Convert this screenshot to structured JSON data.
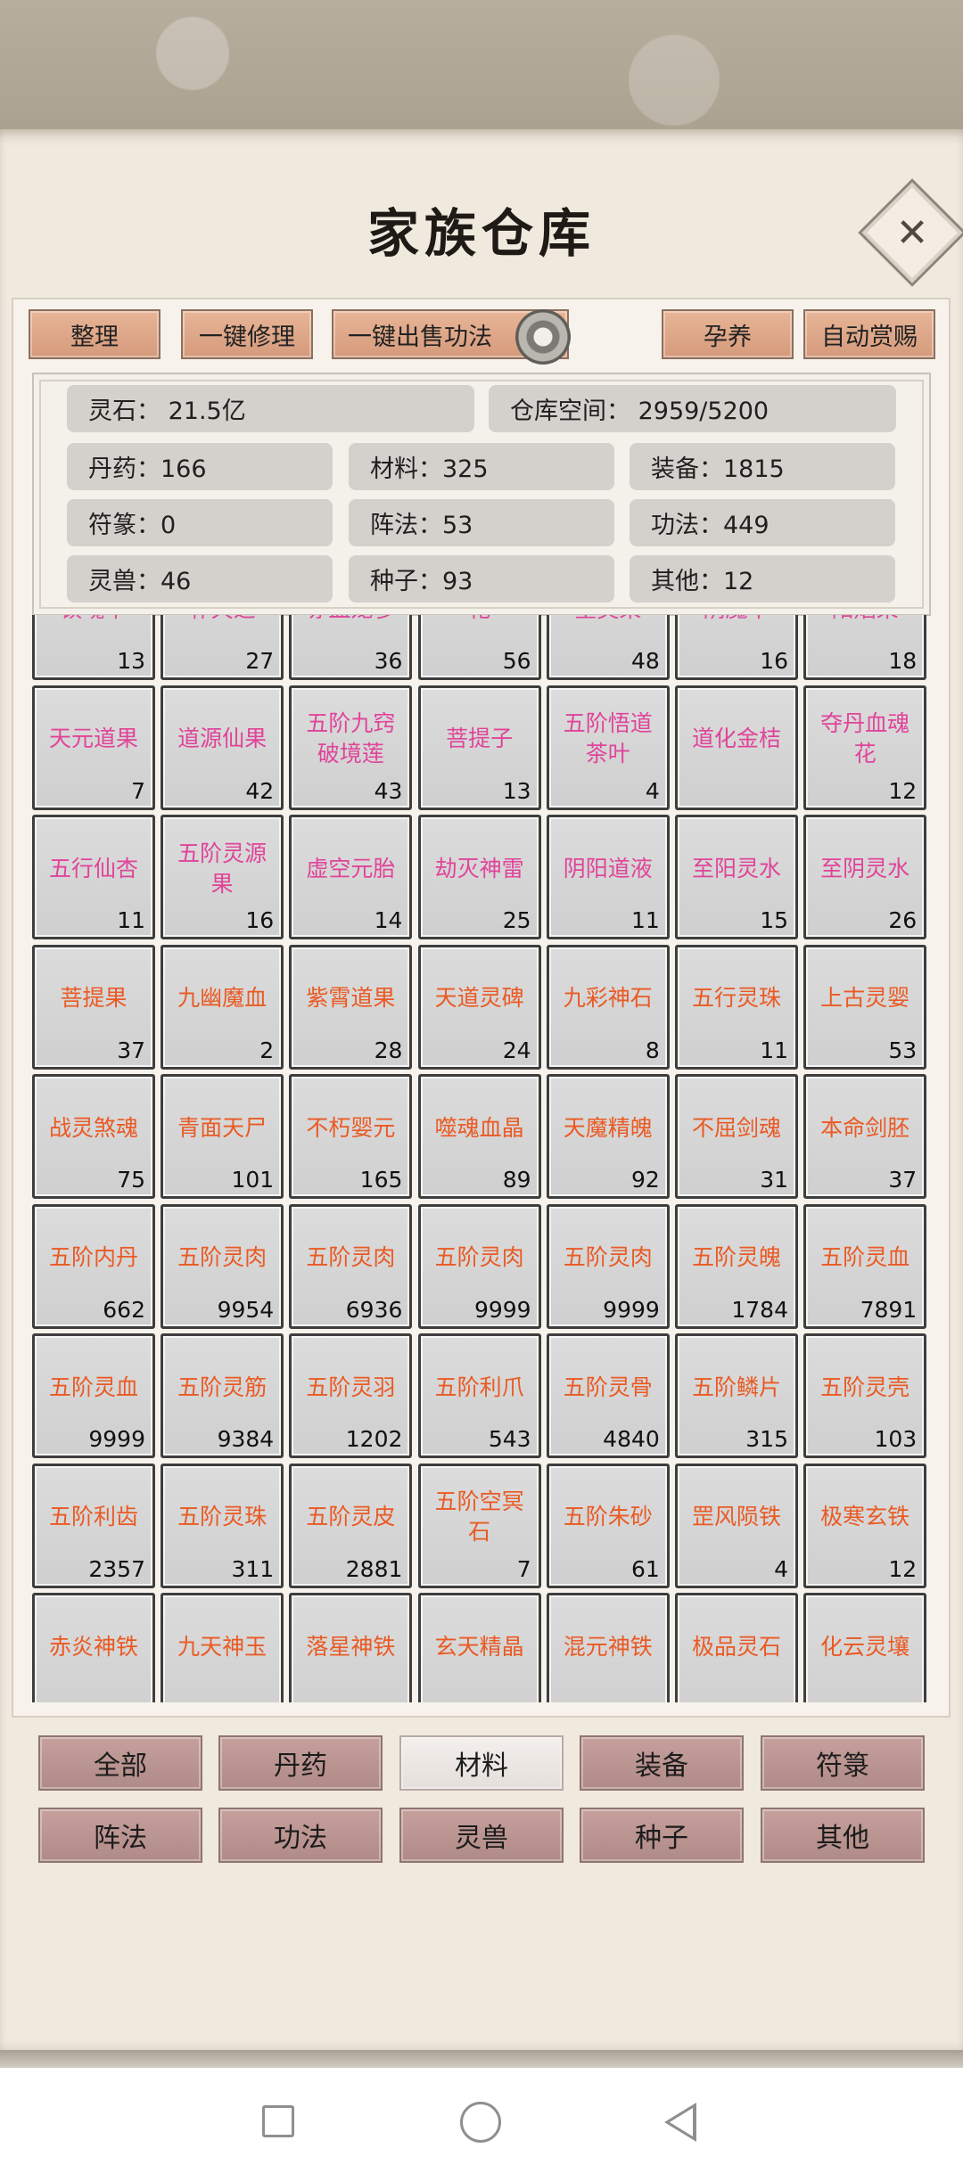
{
  "title": "家族仓库",
  "top_buttons": [
    "整理",
    "一键修理",
    "一键出售功法",
    "孕养",
    "自动赏赐"
  ],
  "info": {
    "spirit_stone": "灵石：  21.5亿",
    "storage": "仓库空间：    2959/5200",
    "stats": [
      "丹药：166",
      "材料：325",
      "装备：1815",
      "符篆：0",
      "阵法：53",
      "功法：449",
      "灵兽：46",
      "种子：93",
      "其他：12"
    ]
  },
  "items": [
    {
      "name": "镇魂草",
      "count": "13",
      "color": "#e0449a"
    },
    {
      "name": "补天芝",
      "count": "27",
      "color": "#e0449a"
    },
    {
      "name": "赤血龙参",
      "count": "36",
      "color": "#e0449a"
    },
    {
      "name": "花",
      "count": "56",
      "color": "#e0449a"
    },
    {
      "name": "星灵果",
      "count": "48",
      "color": "#e0449a"
    },
    {
      "name": "阴魔草",
      "count": "16",
      "color": "#e0449a"
    },
    {
      "name": "阳焰果",
      "count": "18",
      "color": "#e0449a"
    },
    {
      "name": "天元道果",
      "count": "7",
      "color": "#e0449a"
    },
    {
      "name": "道源仙果",
      "count": "42",
      "color": "#e0449a"
    },
    {
      "name": "五阶九窍破境莲",
      "count": "43",
      "color": "#e0449a"
    },
    {
      "name": "菩提子",
      "count": "13",
      "color": "#e0449a"
    },
    {
      "name": "五阶悟道茶叶",
      "count": "4",
      "color": "#e0449a"
    },
    {
      "name": "道化金桔",
      "count": "",
      "color": "#e0449a"
    },
    {
      "name": "夺丹血魂花",
      "count": "12",
      "color": "#e0449a"
    },
    {
      "name": "五行仙杏",
      "count": "11",
      "color": "#e0449a"
    },
    {
      "name": "五阶灵源果",
      "count": "16",
      "color": "#e0449a"
    },
    {
      "name": "虚空元胎",
      "count": "14",
      "color": "#e0449a"
    },
    {
      "name": "劫灭神雷",
      "count": "25",
      "color": "#e0449a"
    },
    {
      "name": "阴阳道液",
      "count": "11",
      "color": "#e0449a"
    },
    {
      "name": "至阳灵水",
      "count": "15",
      "color": "#e0449a"
    },
    {
      "name": "至阴灵水",
      "count": "26",
      "color": "#e0449a"
    },
    {
      "name": "菩提果",
      "count": "37",
      "color": "#ea5a24"
    },
    {
      "name": "九幽魔血",
      "count": "2",
      "color": "#ea5a24"
    },
    {
      "name": "紫霄道果",
      "count": "28",
      "color": "#ea5a24"
    },
    {
      "name": "天道灵碑",
      "count": "24",
      "color": "#ea5a24"
    },
    {
      "name": "九彩神石",
      "count": "8",
      "color": "#ea5a24"
    },
    {
      "name": "五行灵珠",
      "count": "11",
      "color": "#ea5a24"
    },
    {
      "name": "上古灵婴",
      "count": "53",
      "color": "#ea5a24"
    },
    {
      "name": "战灵煞魂",
      "count": "75",
      "color": "#ea5a24"
    },
    {
      "name": "青面天尸",
      "count": "101",
      "color": "#ea5a24"
    },
    {
      "name": "不朽婴元",
      "count": "165",
      "color": "#ea5a24"
    },
    {
      "name": "噬魂血晶",
      "count": "89",
      "color": "#ea5a24"
    },
    {
      "name": "天魔精魄",
      "count": "92",
      "color": "#ea5a24"
    },
    {
      "name": "不屈剑魂",
      "count": "31",
      "color": "#ea5a24"
    },
    {
      "name": "本命剑胚",
      "count": "37",
      "color": "#ea5a24"
    },
    {
      "name": "五阶内丹",
      "count": "662",
      "color": "#ea5a24"
    },
    {
      "name": "五阶灵肉",
      "count": "9954",
      "color": "#ea5a24"
    },
    {
      "name": "五阶灵肉",
      "count": "6936",
      "color": "#ea5a24"
    },
    {
      "name": "五阶灵肉",
      "count": "9999",
      "color": "#ea5a24"
    },
    {
      "name": "五阶灵肉",
      "count": "9999",
      "color": "#ea5a24"
    },
    {
      "name": "五阶灵魄",
      "count": "1784",
      "color": "#ea5a24"
    },
    {
      "name": "五阶灵血",
      "count": "7891",
      "color": "#ea5a24"
    },
    {
      "name": "五阶灵血",
      "count": "9999",
      "color": "#ea5a24"
    },
    {
      "name": "五阶灵筋",
      "count": "9384",
      "color": "#ea5a24"
    },
    {
      "name": "五阶灵羽",
      "count": "1202",
      "color": "#ea5a24"
    },
    {
      "name": "五阶利爪",
      "count": "543",
      "color": "#ea5a24"
    },
    {
      "name": "五阶灵骨",
      "count": "4840",
      "color": "#ea5a24"
    },
    {
      "name": "五阶鳞片",
      "count": "315",
      "color": "#ea5a24"
    },
    {
      "name": "五阶灵壳",
      "count": "103",
      "color": "#ea5a24"
    },
    {
      "name": "五阶利齿",
      "count": "2357",
      "color": "#ea5a24"
    },
    {
      "name": "五阶灵珠",
      "count": "311",
      "color": "#ea5a24"
    },
    {
      "name": "五阶灵皮",
      "count": "2881",
      "color": "#ea5a24"
    },
    {
      "name": "五阶空冥石",
      "count": "7",
      "color": "#ea5a24"
    },
    {
      "name": "五阶朱砂",
      "count": "61",
      "color": "#ea5a24"
    },
    {
      "name": "罡风陨铁",
      "count": "4",
      "color": "#ea5a24"
    },
    {
      "name": "极寒玄铁",
      "count": "12",
      "color": "#ea5a24"
    },
    {
      "name": "赤炎神铁",
      "count": "",
      "color": "#ea5a24"
    },
    {
      "name": "九天神玉",
      "count": "",
      "color": "#ea5a24"
    },
    {
      "name": "落星神铁",
      "count": "",
      "color": "#ea5a24"
    },
    {
      "name": "玄天精晶",
      "count": "",
      "color": "#ea5a24"
    },
    {
      "name": "混元神铁",
      "count": "",
      "color": "#ea5a24"
    },
    {
      "name": "极品灵石",
      "count": "",
      "color": "#ea5a24"
    },
    {
      "name": "化云灵壤",
      "count": "",
      "color": "#ea5a24"
    }
  ],
  "categories": [
    "全部",
    "丹药",
    "材料",
    "装备",
    "符箓",
    "阵法",
    "功法",
    "灵兽",
    "种子",
    "其他"
  ],
  "active_category": "材料"
}
